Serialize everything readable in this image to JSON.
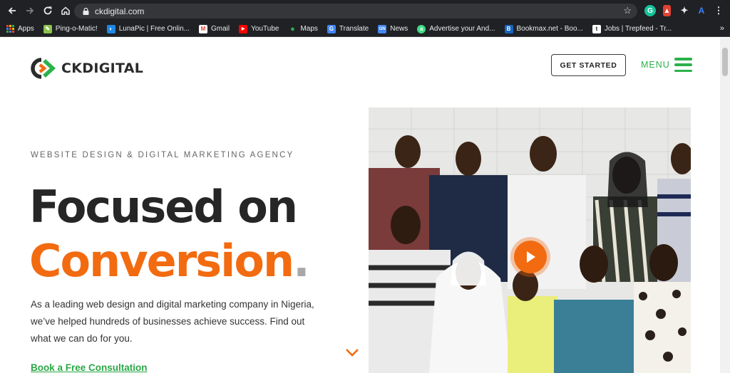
{
  "browser": {
    "url": "ckdigital.com",
    "bookmarks": [
      {
        "label": "Apps",
        "icon": "apps-grid-icon",
        "color": "#ea4335"
      },
      {
        "label": "Ping-o-Matic!",
        "icon": "ping-o-matic-icon",
        "color": "#8bc34a"
      },
      {
        "label": "LunaPic | Free Onlin...",
        "icon": "lunapic-icon",
        "color": "#1e88e5"
      },
      {
        "label": "Gmail",
        "icon": "gmail-icon",
        "color": "#ea4335"
      },
      {
        "label": "YouTube",
        "icon": "youtube-icon",
        "color": "#ff0000"
      },
      {
        "label": "Maps",
        "icon": "maps-pin-icon",
        "color": "#34a853"
      },
      {
        "label": "Translate",
        "icon": "translate-icon",
        "color": "#4285f4"
      },
      {
        "label": "News",
        "icon": "news-icon",
        "color": "#4285f4"
      },
      {
        "label": "Advertise your And...",
        "icon": "android-icon",
        "color": "#3ddc84"
      },
      {
        "label": "Bookmax.net - Boo...",
        "icon": "bookmax-icon",
        "color": "#1565c0"
      },
      {
        "label": "Jobs | Trepfeed - Tr...",
        "icon": "trepfeed-icon",
        "color": "#111111"
      }
    ],
    "more_bookmarks": "»"
  },
  "header": {
    "logo_text": "CKDIGITAL",
    "get_started_label": "GET STARTED",
    "menu_label": "MENU"
  },
  "hero": {
    "tagline": "WEBSITE DESIGN & DIGITAL MARKETING AGENCY",
    "headline_line1": "Focused on",
    "headline_line2": "Conversion",
    "headline_dot": ".",
    "description": "As a leading web design and digital marketing company in Nigeria, we’ve helped hundreds of businesses achieve success. Find out what we can do for you.",
    "cta_link": "Book a Free Consultation"
  },
  "colors": {
    "brand_orange": "#f26b10",
    "brand_green": "#2bb24a",
    "dark_text": "#262626"
  }
}
